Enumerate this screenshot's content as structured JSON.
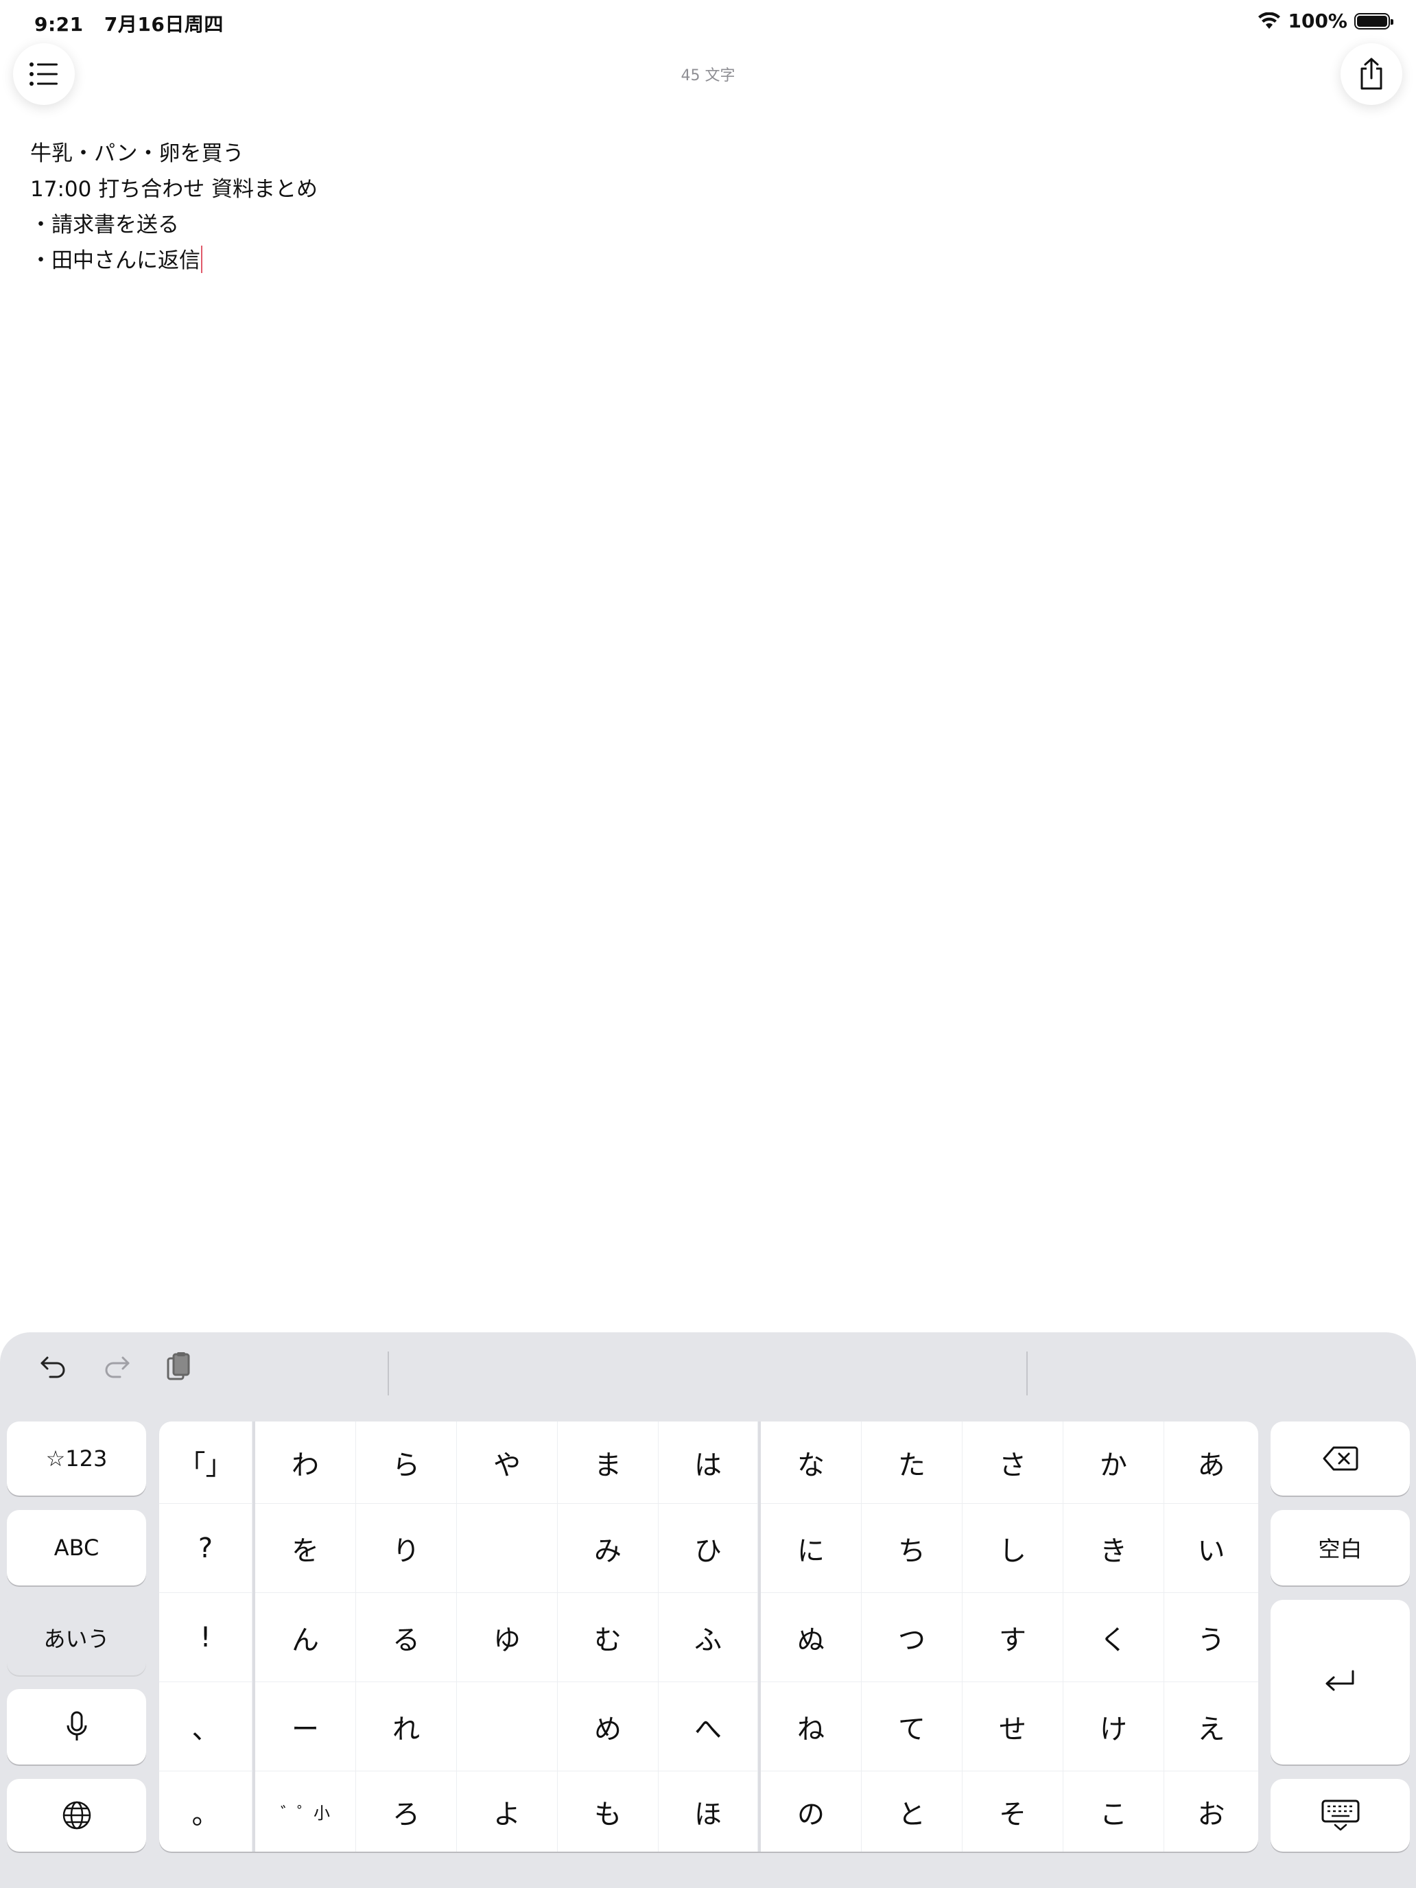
{
  "status": {
    "time": "9:21",
    "date": "7月16日周四",
    "battery": "100%"
  },
  "header": {
    "counter": "45 文字"
  },
  "editor": {
    "lines": [
      "牛乳・パン・卵を買う",
      "17:00 打ち合わせ 資料まとめ",
      "・請求書を送る",
      "・田中さんに返信"
    ]
  },
  "keyboard": {
    "left_keys": {
      "symbols": "☆123",
      "abc": "ABC",
      "kana": "あいう"
    },
    "punct": [
      "「」",
      "?",
      "!",
      "、",
      "。"
    ],
    "kana_grid": [
      [
        "わ",
        "ら",
        "や",
        "ま",
        "は",
        "な",
        "た",
        "さ",
        "か",
        "あ"
      ],
      [
        "を",
        "り",
        "",
        "み",
        "ひ",
        "に",
        "ち",
        "し",
        "き",
        "い"
      ],
      [
        "ん",
        "る",
        "ゆ",
        "む",
        "ふ",
        "ぬ",
        "つ",
        "す",
        "く",
        "う"
      ],
      [
        "ー",
        "れ",
        "",
        "め",
        "へ",
        "ね",
        "て",
        "せ",
        "け",
        "え"
      ],
      [
        "゛゜小",
        "ろ",
        "よ",
        "も",
        "ほ",
        "の",
        "と",
        "そ",
        "こ",
        "お"
      ]
    ],
    "right_keys": {
      "space": "空白"
    },
    "selected_mode": "あいう"
  },
  "icons": {
    "wifi": "wifi-icon",
    "battery": "battery-icon",
    "list": "list-icon",
    "share": "share-icon",
    "undo": "undo-icon",
    "redo": "redo-icon",
    "paste": "paste-icon",
    "backspace": "backspace-icon",
    "return": "return-icon",
    "microphone": "microphone-icon",
    "globe": "globe-icon",
    "dismiss": "keyboard-dismiss-icon"
  },
  "colors": {
    "caret": "#e05a6a",
    "keyboard_bg": "#e4e5e9"
  }
}
